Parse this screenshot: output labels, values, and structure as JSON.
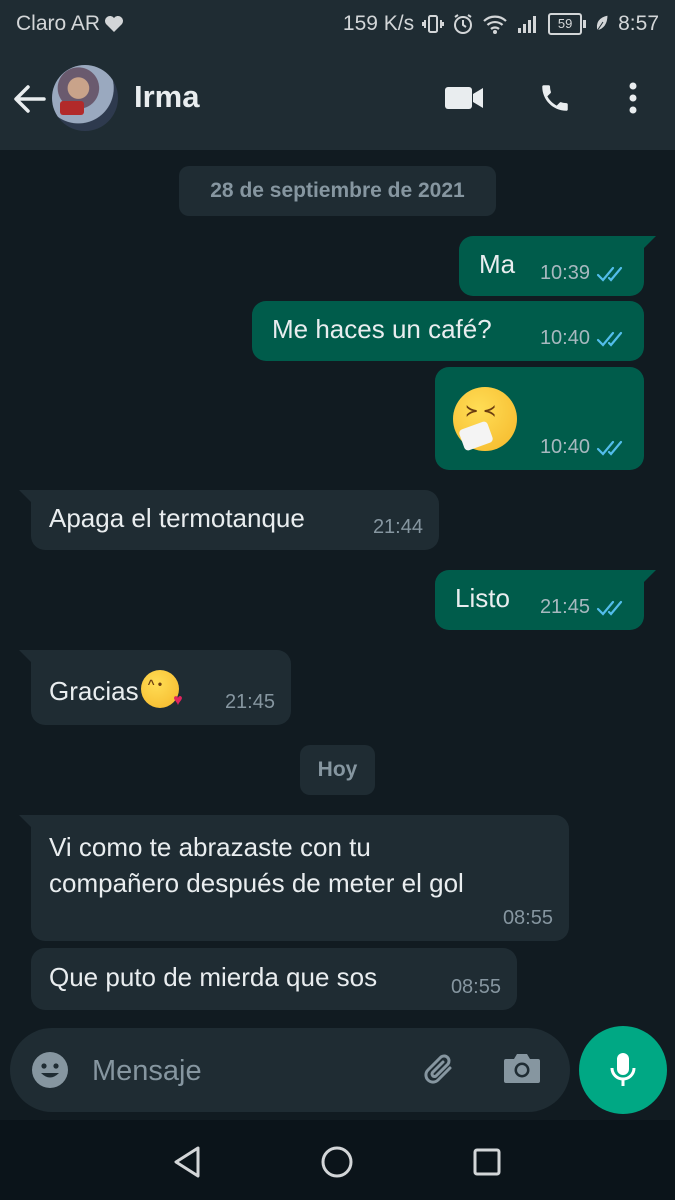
{
  "status_bar": {
    "carrier": "Claro AR",
    "net_speed": "159 K/s",
    "battery": "59",
    "time": "8:57"
  },
  "header": {
    "contact_name": "Irma"
  },
  "chat": {
    "date_chips": [
      {
        "label": "28 de septiembre de 2021"
      },
      {
        "label": "Hoy"
      }
    ],
    "messages": [
      {
        "direction": "out",
        "text": "Ma",
        "time": "10:39",
        "read": true
      },
      {
        "direction": "out",
        "text": "Me haces un café?",
        "time": "10:40",
        "read": true
      },
      {
        "direction": "out",
        "text": "",
        "emoji": "sneezing-face",
        "time": "10:40",
        "read": true
      },
      {
        "direction": "in",
        "text": "Apaga el termotanque",
        "time": "21:44"
      },
      {
        "direction": "out",
        "text": "Listo",
        "time": "21:45",
        "read": true
      },
      {
        "direction": "in",
        "text": "Gracias",
        "emoji": "face-blowing-kiss",
        "time": "21:45"
      },
      {
        "direction": "in",
        "lines": [
          "Vi como te abrazaste con tu",
          "compañero después de meter el gol"
        ],
        "time": "08:55"
      },
      {
        "direction": "in",
        "text": "Que puto de mierda que sos",
        "time": "08:55"
      }
    ]
  },
  "input": {
    "placeholder": "Mensaje"
  },
  "colors": {
    "background": "#111b21",
    "header": "#1f2c33",
    "outgoing_bubble": "#005c4b",
    "incoming_bubble": "#1f2c33",
    "read_ticks": "#53bdeb",
    "mic_button": "#00a884"
  },
  "icons": [
    "heart-icon",
    "vibrate-icon",
    "alarm-icon",
    "wifi-icon",
    "signal-icon",
    "battery-icon",
    "leaf-icon",
    "back-arrow-icon",
    "video-call-icon",
    "phone-icon",
    "more-vert-icon",
    "emoji-icon",
    "attach-icon",
    "camera-icon",
    "mic-icon",
    "nav-back-icon",
    "nav-home-icon",
    "nav-recents-icon"
  ]
}
